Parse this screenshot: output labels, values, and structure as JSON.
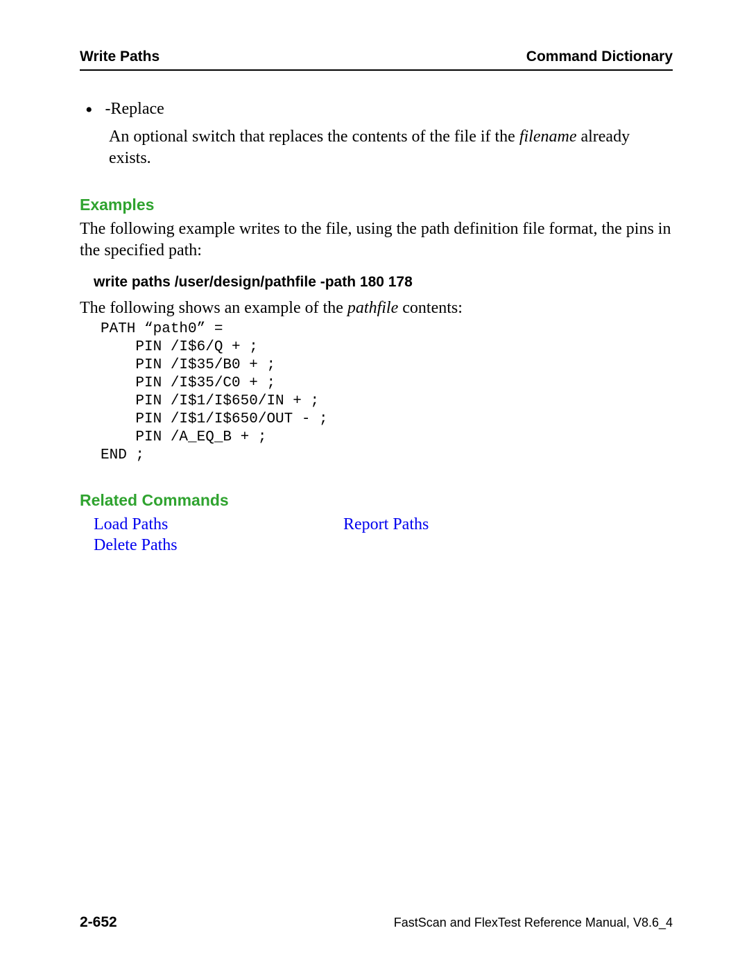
{
  "header": {
    "left": "Write Paths",
    "right": "Command Dictionary"
  },
  "bullet": {
    "label": "-Replace",
    "desc_before": "An optional switch that replaces the contents of the file if the ",
    "desc_italic": "filename",
    "desc_after": " already exists."
  },
  "sections": {
    "examples_heading": "Examples",
    "examples_intro": "The following example writes to the file, using the path definition file format, the pins in the specified path:",
    "example_command": "write paths /user/design/pathfile -path 180 178",
    "example_para_before": "The following shows an example of the ",
    "example_para_italic": "pathfile",
    "example_para_after": " contents:",
    "code": "PATH “path0” =\n    PIN /I$6/Q + ;\n    PIN /I$35/B0 + ;\n    PIN /I$35/C0 + ;\n    PIN /I$1/I$650/IN + ;\n    PIN /I$1/I$650/OUT - ;\n    PIN /A_EQ_B + ;\nEND ;",
    "related_heading": "Related Commands"
  },
  "related": {
    "load_paths": "Load Paths",
    "report_paths": "Report Paths",
    "delete_paths": "Delete Paths"
  },
  "footer": {
    "page_number": "2-652",
    "manual_title": "FastScan and FlexTest Reference Manual, V8.6_4"
  }
}
